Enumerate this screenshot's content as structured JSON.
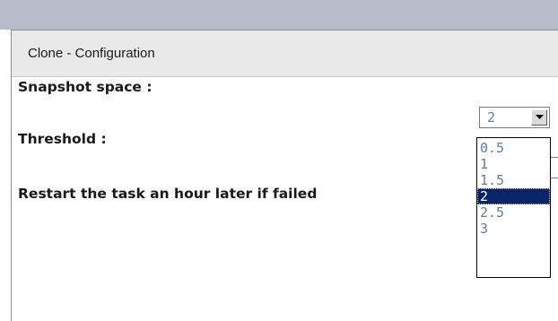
{
  "dialog": {
    "title": "Clone - Configuration"
  },
  "form": {
    "snapshot_space_label": "Snapshot space :",
    "threshold_label": "Threshold :",
    "restart_label": "Restart the task an hour later if failed"
  },
  "snapshot_select": {
    "selected_value": "2",
    "options": [
      "0.5",
      "1",
      "1.5",
      "2",
      "2.5",
      "3"
    ],
    "selected_index": 3,
    "icon": "chevron-down-icon"
  },
  "colors": {
    "header_band": "#b6bcca",
    "panel_header": "#e9e9e9",
    "option_text": "#5b7fa8",
    "selected_option_bg": "#0a246a",
    "selected_option_text": "#ffffff"
  }
}
